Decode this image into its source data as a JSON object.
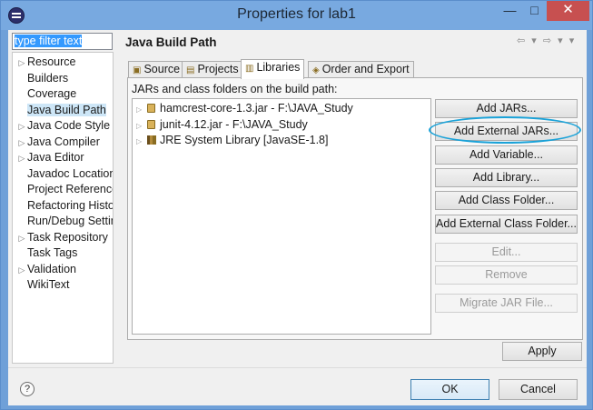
{
  "window": {
    "title": "Properties for lab1",
    "minimize": "—",
    "maximize": "□",
    "close": "✕"
  },
  "filter": {
    "value": "type filter text"
  },
  "left_tree": {
    "items": [
      {
        "label": "Resource",
        "expandable": true
      },
      {
        "label": "Builders",
        "expandable": false
      },
      {
        "label": "Coverage",
        "expandable": false
      },
      {
        "label": "Java Build Path",
        "expandable": false,
        "selected": true
      },
      {
        "label": "Java Code Style",
        "expandable": true
      },
      {
        "label": "Java Compiler",
        "expandable": true
      },
      {
        "label": "Java Editor",
        "expandable": true
      },
      {
        "label": "Javadoc Location",
        "expandable": false
      },
      {
        "label": "Project References",
        "expandable": false
      },
      {
        "label": "Refactoring History",
        "expandable": false
      },
      {
        "label": "Run/Debug Settings",
        "expandable": false
      },
      {
        "label": "Task Repository",
        "expandable": true
      },
      {
        "label": "Task Tags",
        "expandable": false
      },
      {
        "label": "Validation",
        "expandable": true
      },
      {
        "label": "WikiText",
        "expandable": false
      }
    ]
  },
  "page": {
    "title": "Java Build Path",
    "nav": "⇦ ▾ ⇨ ▾ ▾"
  },
  "tabs": [
    {
      "label": "Source",
      "active": false
    },
    {
      "label": "Projects",
      "active": false
    },
    {
      "label": "Libraries",
      "active": true
    },
    {
      "label": "Order and Export",
      "active": false
    }
  ],
  "libraries": {
    "heading": "JARs and class folders on the build path:",
    "items": [
      {
        "label": "hamcrest-core-1.3.jar - F:\\JAVA_Study",
        "icon": "jar-icon"
      },
      {
        "label": "junit-4.12.jar - F:\\JAVA_Study",
        "icon": "jar-icon"
      },
      {
        "label": "JRE System Library [JavaSE-1.8]",
        "icon": "library-icon"
      }
    ]
  },
  "buttons": {
    "add_jars": "Add JARs...",
    "add_external_jars": "Add External JARs...",
    "add_variable": "Add Variable...",
    "add_library": "Add Library...",
    "add_class_folder": "Add Class Folder...",
    "add_external_class_folder": "Add External Class Folder...",
    "edit": "Edit...",
    "remove": "Remove",
    "migrate_jar": "Migrate JAR File...",
    "apply": "Apply",
    "ok": "OK",
    "cancel": "Cancel",
    "help": "?"
  },
  "colors": {
    "highlight_ellipse": "#1aa2d8",
    "selection": "#cde6f7",
    "close_button": "#c75050"
  }
}
